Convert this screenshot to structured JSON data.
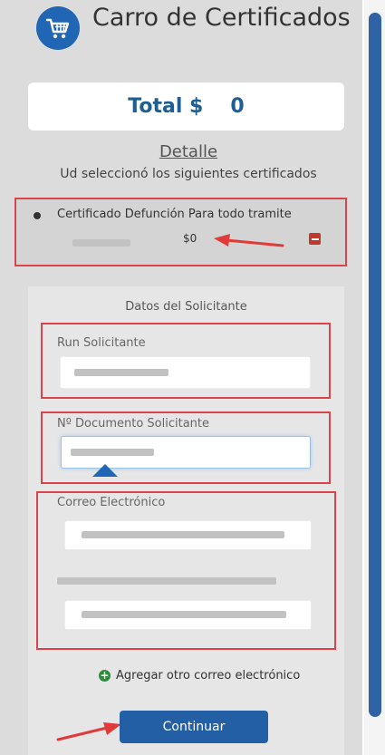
{
  "header": {
    "title": "Carro de Certificados",
    "icon": "cart-icon"
  },
  "total": {
    "label": "Total $",
    "value": "0"
  },
  "detail": {
    "heading": "Detalle",
    "subtitle": "Ud seleccionó los siguientes certificados"
  },
  "items": [
    {
      "name": "Certificado Defunción Para todo tramite",
      "price": "$0"
    }
  ],
  "form": {
    "title": "Datos del Solicitante",
    "run_label": "Run Solicitante",
    "doc_label": "Nº Documento Solicitante",
    "email_label": "Correo Electrónico",
    "add_email_label": "Agregar otro correo electrónico",
    "continue_label": "Continuar"
  },
  "colors": {
    "accent": "#2166b4",
    "button": "#235fa4",
    "annotation": "#d9444a",
    "remove": "#c0392b"
  }
}
